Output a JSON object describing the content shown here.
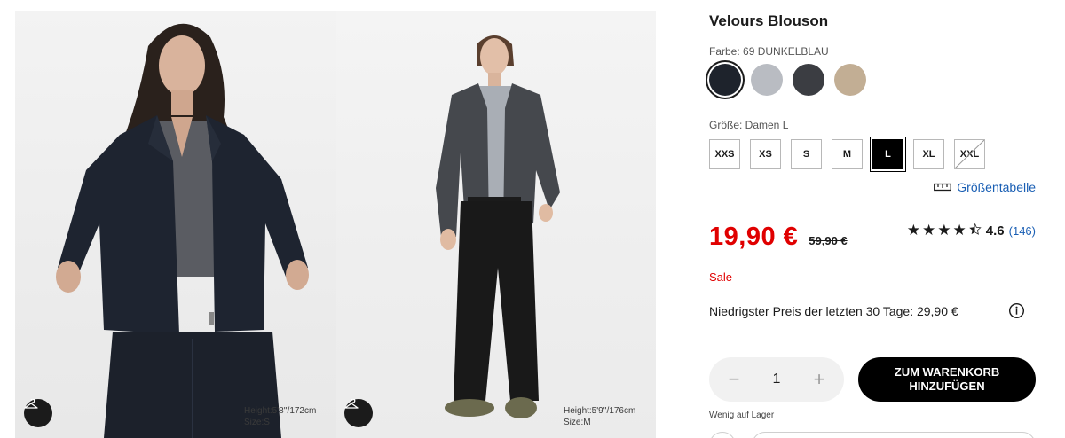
{
  "product": {
    "title": "Velours Blouson",
    "color_label": "Farbe: 69 DUNKELBLAU",
    "colors": [
      {
        "name": "navy",
        "hex": "#1e232c",
        "selected": true
      },
      {
        "name": "light-gray",
        "hex": "#b9bcc2",
        "selected": false
      },
      {
        "name": "dark-gray",
        "hex": "#3b3d42",
        "selected": false
      },
      {
        "name": "beige",
        "hex": "#c2ae94",
        "selected": false
      }
    ],
    "size_label": "Größe: Damen L",
    "sizes": [
      {
        "label": "XXS",
        "state": "available"
      },
      {
        "label": "XS",
        "state": "available"
      },
      {
        "label": "S",
        "state": "available"
      },
      {
        "label": "M",
        "state": "available"
      },
      {
        "label": "L",
        "state": "selected"
      },
      {
        "label": "XL",
        "state": "available"
      },
      {
        "label": "XXL",
        "state": "unavailable"
      }
    ],
    "size_chart_label": "Größentabelle",
    "price_now": "19,90 €",
    "price_old": "59,90 €",
    "rating": {
      "stars": 4.5,
      "value": "4.6",
      "count": "(146)"
    },
    "sale_label": "Sale",
    "lowest_price": "Niedrigster Preis der letzten 30 Tage: 29,90 €",
    "quantity": "1",
    "add_to_cart": "ZUM WARENKORB\nHINZUFÜGEN",
    "stock_status": "Wenig auf Lager"
  },
  "images": [
    {
      "model_height": "Height:5'8''/172cm",
      "model_size": "Size:S",
      "icon": "hanger-icon"
    },
    {
      "model_height": "Height:5'9''/176cm",
      "model_size": "Size:M",
      "icon": "hanger-icon"
    }
  ],
  "colors": {
    "accent_red": "#e00000",
    "link_blue": "#1a5fb4",
    "text": "#1b1b1b"
  }
}
